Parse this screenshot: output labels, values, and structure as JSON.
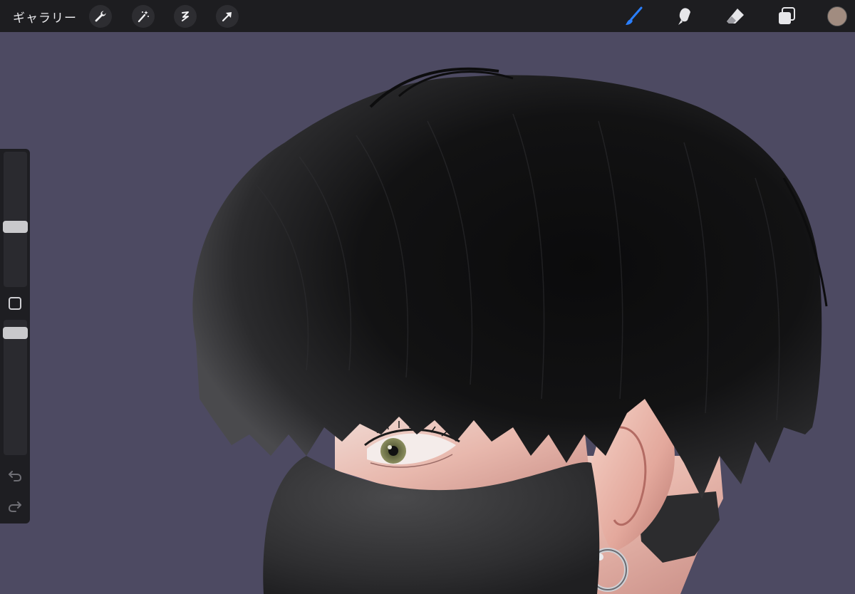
{
  "topbar": {
    "gallery_label": "ギャラリー",
    "left_tools": [
      "actions-icon",
      "adjustments-icon",
      "selection-icon",
      "transform-icon"
    ],
    "right_tools": [
      "brush-icon",
      "smudge-icon",
      "eraser-icon",
      "layers-icon"
    ],
    "active_tool": "brush-icon",
    "accent_color": "#2a7fff",
    "current_color": "#a18c80"
  },
  "canvas": {
    "background_color": "#4d4a62"
  },
  "sidebar": {
    "brush_size_level": 0.44,
    "opacity_level": 0.94,
    "buttons": [
      "modifier-square-icon",
      "undo-icon",
      "redo-icon"
    ]
  }
}
